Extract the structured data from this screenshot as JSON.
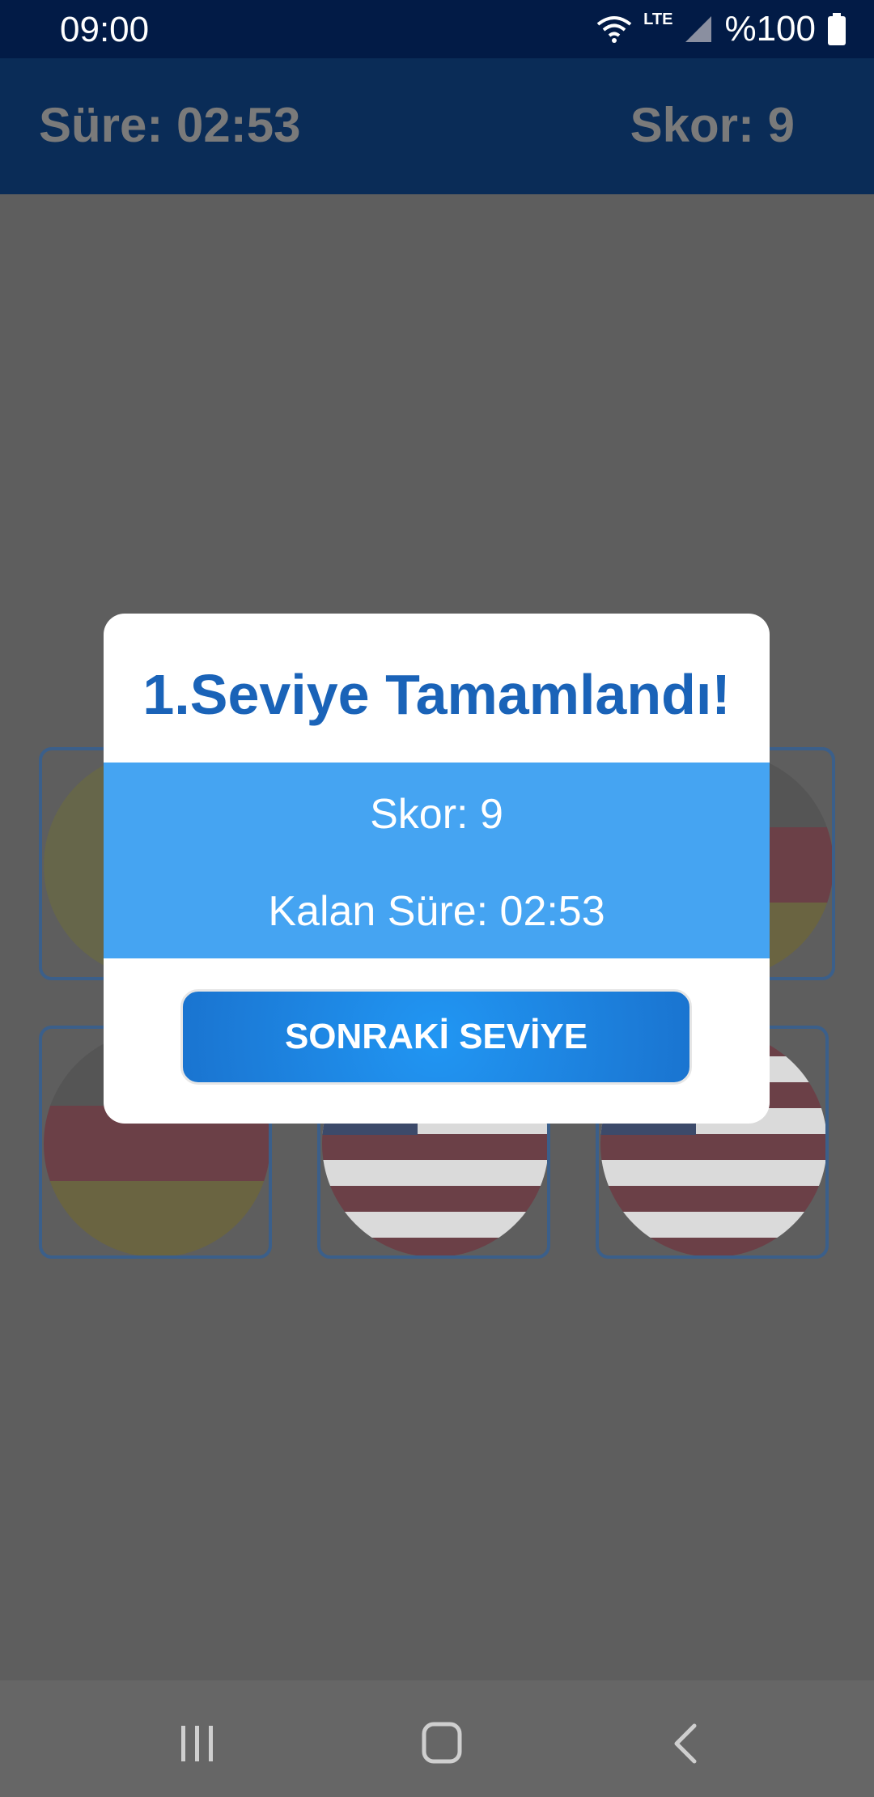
{
  "status_bar": {
    "time": "09:00",
    "network": "LTE",
    "battery": "%100"
  },
  "header": {
    "time_label": "Süre: 02:53",
    "score_label": "Skor: 9"
  },
  "dialog": {
    "title": "1.Seviye Tamamlandı!",
    "score_line": "Skor: 9",
    "time_line": "Kalan Süre: 02:53",
    "next_button": "SONRAKİ SEVİYE"
  },
  "cards": [
    {
      "flag": "partial"
    },
    {
      "flag": "germany"
    },
    {
      "flag": "germany"
    },
    {
      "flag": "usa"
    },
    {
      "flag": "usa"
    }
  ],
  "nav": {
    "recent": "recent-apps",
    "home": "home",
    "back": "back"
  },
  "colors": {
    "accent": "#1a63b8",
    "band": "#45a4f2",
    "header_bg": "#0a2c57"
  }
}
